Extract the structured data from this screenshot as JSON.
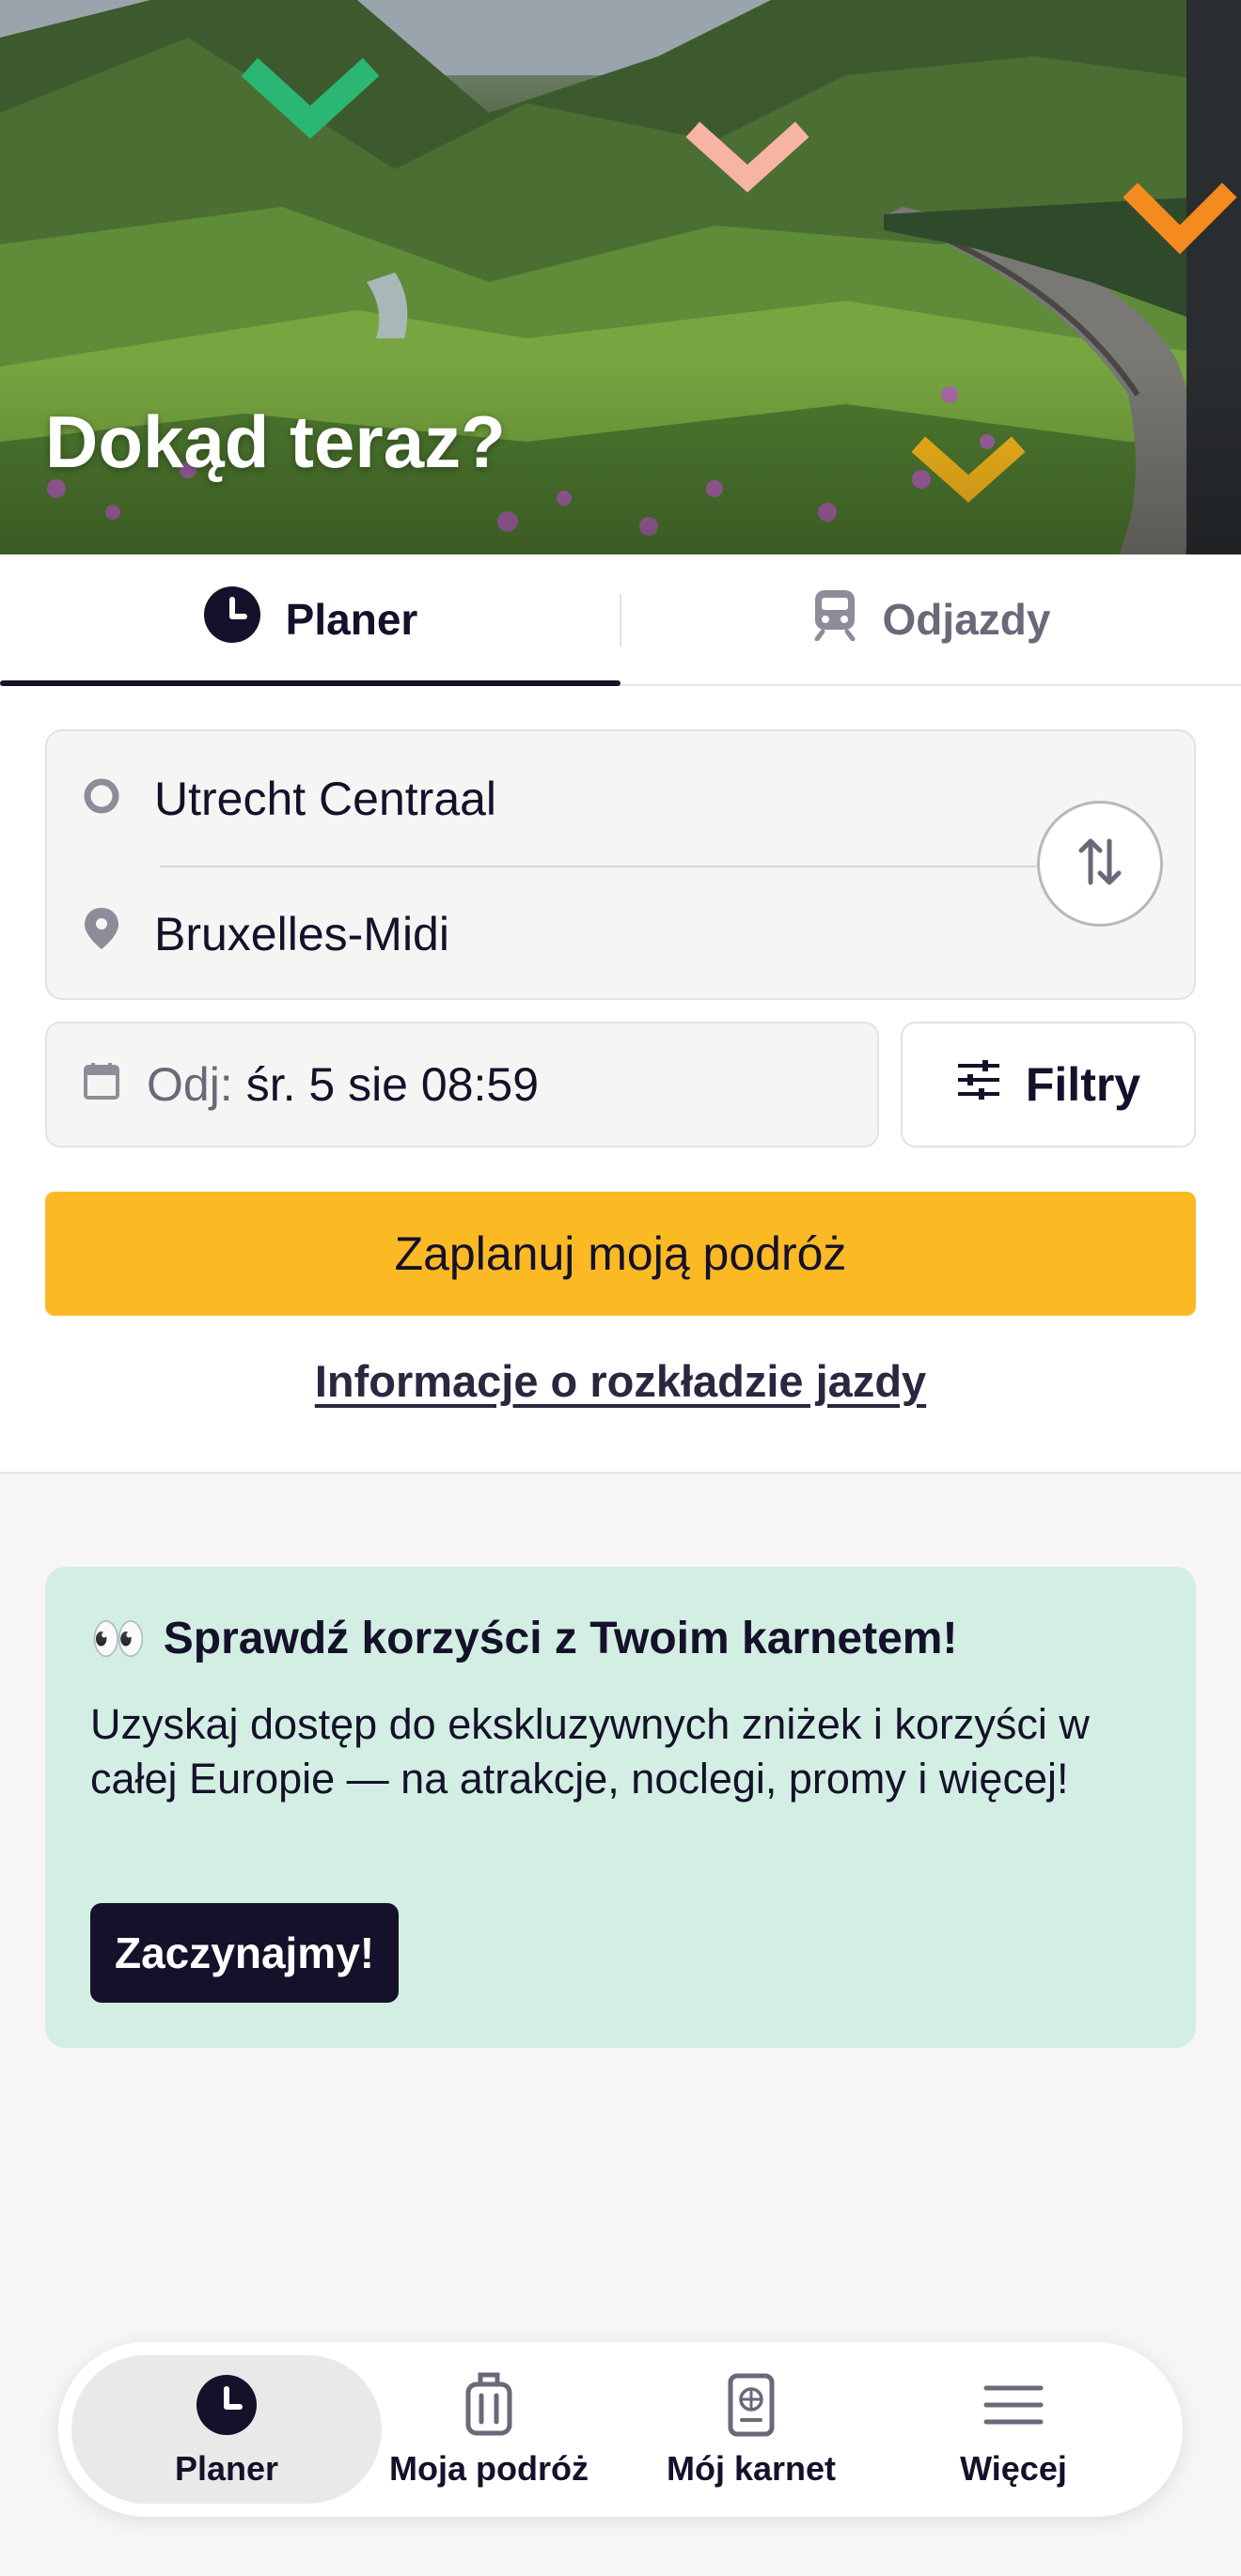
{
  "hero": {
    "title": "Dokąd teraz?"
  },
  "tabs": [
    {
      "label": "Planer",
      "icon": "clock-icon",
      "active": true
    },
    {
      "label": "Odjazdy",
      "icon": "train-icon",
      "active": false
    }
  ],
  "search": {
    "from": "Utrecht Centraal",
    "to": "Bruxelles-Midi",
    "date_prefix": "Odj:",
    "date_value": "śr. 5 sie 08:59",
    "filters_label": "Filtry",
    "plan_button": "Zaplanuj moją podróż",
    "timetable_link": "Informacje o rozkładzie jazdy"
  },
  "promo": {
    "emoji": "👀",
    "title": "Sprawdź korzyści z Twoim karnetem!",
    "text": "Uzyskaj dostęp do ekskluzywnych zniżek i korzyści w całej Europie — na atrakcje, noclegi, promy i więcej!",
    "button": "Zaczynajmy!"
  },
  "bottom_nav": [
    {
      "label": "Planer",
      "icon": "clock-icon",
      "active": true
    },
    {
      "label": "Moja podróż",
      "icon": "suitcase-icon",
      "active": false
    },
    {
      "label": "Mój karnet",
      "icon": "pass-icon",
      "active": false
    },
    {
      "label": "Więcej",
      "icon": "menu-icon",
      "active": false
    }
  ],
  "colors": {
    "primary": "#15112b",
    "accent_yellow": "#fbb924",
    "promo_bg": "#d3eee2",
    "chevron_green": "#2bb673",
    "chevron_pink": "#f7b3a3",
    "chevron_orange": "#f58a1f",
    "chevron_yellow": "#f8b81c"
  }
}
